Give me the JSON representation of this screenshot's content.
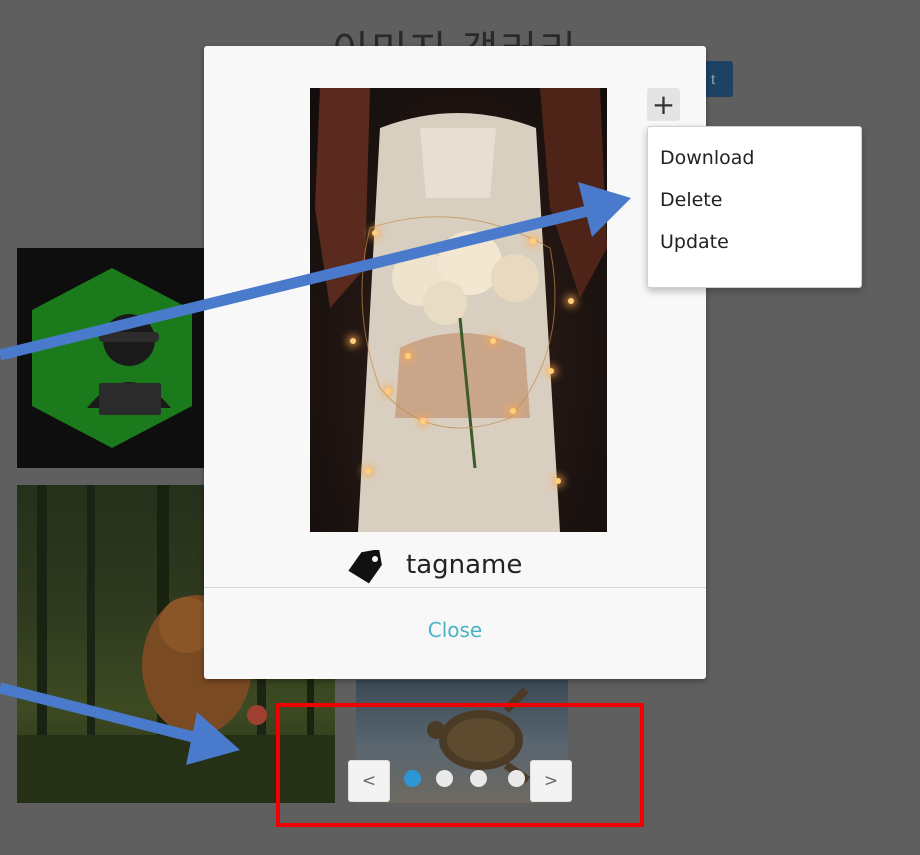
{
  "background": {
    "title": "이미지 갤러리",
    "button_label": "t"
  },
  "modal": {
    "plus_label": "+",
    "tag_icon": "tag-icon",
    "tag_label": "tagname",
    "close_label": "Close"
  },
  "dropdown": {
    "items": [
      {
        "label": "Download"
      },
      {
        "label": "Delete"
      },
      {
        "label": "Update"
      }
    ]
  },
  "pagination": {
    "prev_label": "<",
    "next_label": ">",
    "dots": 4,
    "active_index": 0
  },
  "colors": {
    "overlay": "#5f5f5f",
    "accent": "#2f96d6",
    "close_link": "#4bb3c6",
    "highlight": "#f00000",
    "arrow": "#4a7acb"
  }
}
